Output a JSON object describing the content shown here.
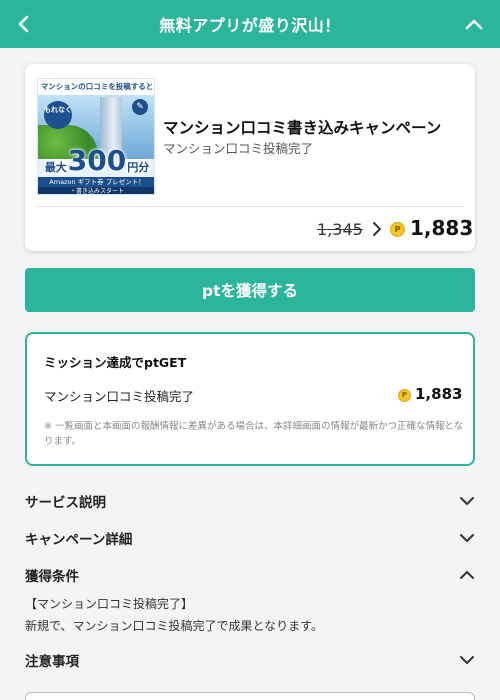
{
  "header": {
    "title": "無料アプリが盛り沢山！",
    "back_icon": "chevron-left-icon",
    "collapse_icon": "chevron-up-icon",
    "color": "#2bb59a"
  },
  "campaign": {
    "banner": {
      "top_text": "マンションの口コミを投稿すると",
      "badge_text": "もれなく",
      "prefix": "最大",
      "amount": "300",
      "suffix": "円分",
      "gift_text": "Amazon ギフト券 プレゼント！",
      "start_text": "・書き込みスタート"
    },
    "title": "マンション口コミ書き込みキャンペーン",
    "subtitle": "マンション口コミ投稿完了",
    "old_points": "1,345",
    "new_points": "1,883",
    "coin_icon": "point-coin-icon"
  },
  "cta": {
    "label": "ptを獲得する"
  },
  "mission": {
    "title": "ミッション達成でptGET",
    "item_label": "マンション口コミ投稿完了",
    "item_points": "1,883",
    "note": "※ 一覧画面と本画面の報酬情報に差異がある場合は、本詳細画面の情報が最新かつ正確な情報となります。"
  },
  "sections": {
    "service": "サービス説明",
    "campaign_detail": "キャンペーン詳細",
    "conditions": "獲得条件",
    "cautions": "注意事項"
  },
  "conditions": {
    "line1": "【マンション口コミ投稿完了】",
    "line2": "新規で、マンション口コミ投稿完了で成果となります。"
  },
  "colors": {
    "accent": "#2bb59a",
    "coin": "#f3c623"
  }
}
